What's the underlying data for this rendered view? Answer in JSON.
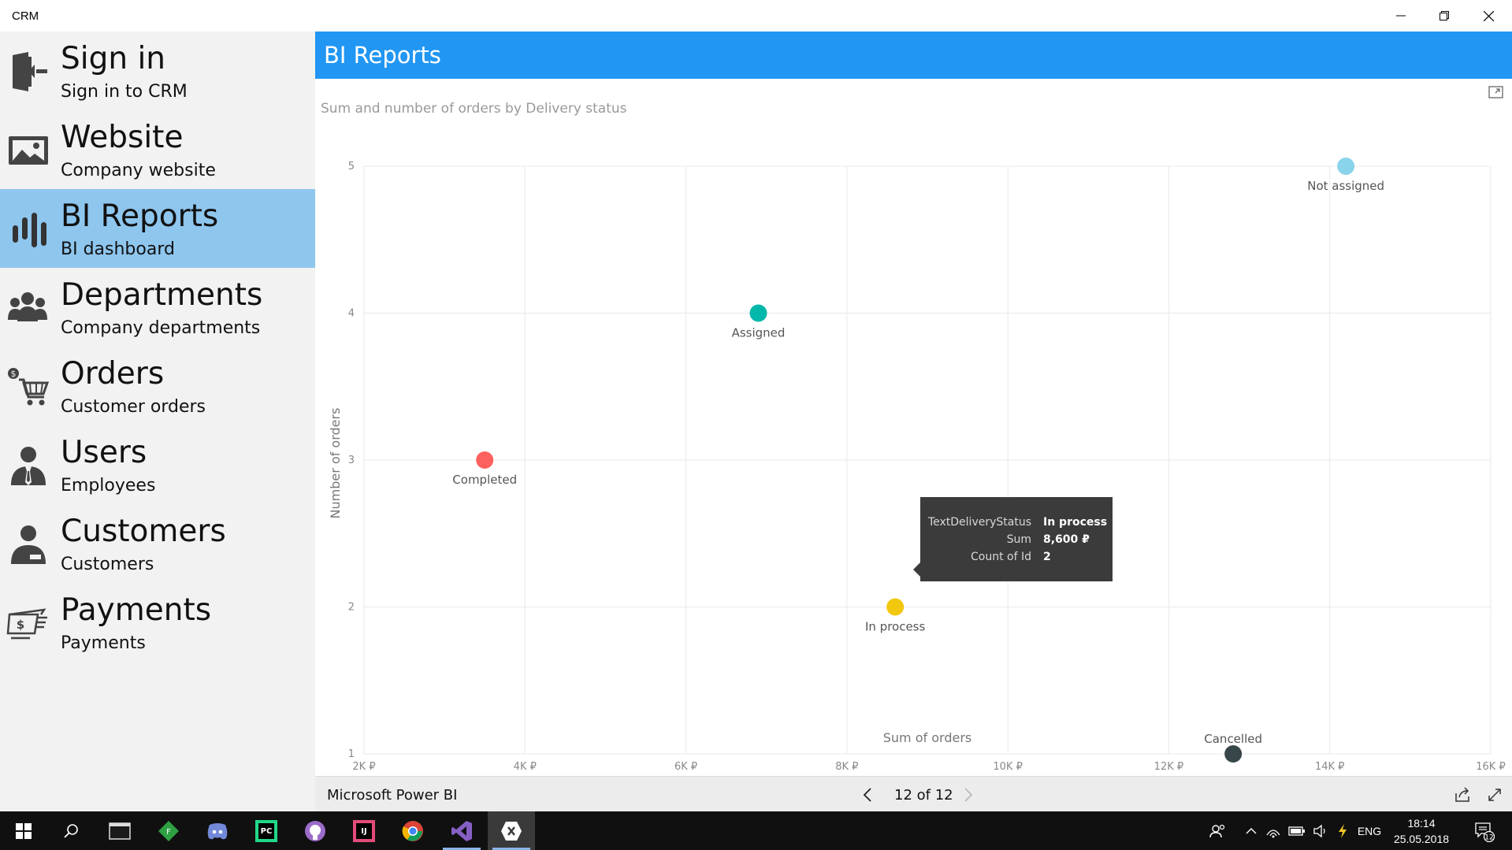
{
  "window": {
    "title": "CRM"
  },
  "sidebar": {
    "items": [
      {
        "title": "Sign in",
        "subtitle": "Sign in to CRM",
        "icon": "sign-in-icon",
        "active": false
      },
      {
        "title": "Website",
        "subtitle": "Company website",
        "icon": "website-image-icon",
        "active": false
      },
      {
        "title": "BI Reports",
        "subtitle": "BI dashboard",
        "icon": "bar-chart-icon",
        "active": true
      },
      {
        "title": "Departments",
        "subtitle": "Company departments",
        "icon": "group-icon",
        "active": false
      },
      {
        "title": "Orders",
        "subtitle": "Customer orders",
        "icon": "shopping-cart-icon",
        "active": false
      },
      {
        "title": "Users",
        "subtitle": "Employees",
        "icon": "user-tie-icon",
        "active": false
      },
      {
        "title": "Customers",
        "subtitle": "Customers",
        "icon": "customer-icon",
        "active": false
      },
      {
        "title": "Payments",
        "subtitle": "Payments",
        "icon": "payment-icon",
        "active": false
      }
    ]
  },
  "main": {
    "header_title": "BI Reports",
    "chart_title": "Sum and number of orders by Delivery status"
  },
  "chart_data": {
    "type": "scatter",
    "title": "Sum and number of orders by Delivery status",
    "xlabel": "Sum of orders",
    "ylabel": "Number of orders",
    "xlim": [
      2000,
      16000
    ],
    "ylim": [
      1,
      5
    ],
    "x_ticks": [
      2000,
      4000,
      6000,
      8000,
      10000,
      12000,
      14000,
      16000
    ],
    "x_tick_labels": [
      "2K ₽",
      "4K ₽",
      "6K ₽",
      "8K ₽",
      "10K ₽",
      "12K ₽",
      "14K ₽",
      "16K ₽"
    ],
    "y_ticks": [
      1,
      2,
      3,
      4,
      5
    ],
    "y_tick_labels": [
      "1",
      "2",
      "3",
      "4",
      "5"
    ],
    "grid": true,
    "points": [
      {
        "label": "Completed",
        "x": 3500,
        "y": 3,
        "color": "#fd625e"
      },
      {
        "label": "Assigned",
        "x": 6900,
        "y": 4,
        "color": "#01b8aa"
      },
      {
        "label": "In process",
        "x": 8600,
        "y": 2,
        "color": "#f2c80f"
      },
      {
        "label": "Cancelled",
        "x": 12800,
        "y": 1,
        "color": "#374649"
      },
      {
        "label": "Not assigned",
        "x": 14200,
        "y": 5,
        "color": "#8ad4eb"
      }
    ]
  },
  "tooltip": {
    "rows": [
      {
        "key": "TextDeliveryStatus",
        "value": "In process"
      },
      {
        "key": "Sum",
        "value": "8,600 ₽"
      },
      {
        "key": "Count of Id",
        "value": "2"
      }
    ]
  },
  "footer": {
    "brand": "Microsoft Power BI",
    "pager": "12 of 12"
  },
  "taskbar": {
    "language": "ENG",
    "time": "18:14",
    "date": "25.05.2018",
    "notifications": "12"
  },
  "colors": {
    "accent": "#2196f3",
    "active_nav": "#8ec6ee"
  }
}
